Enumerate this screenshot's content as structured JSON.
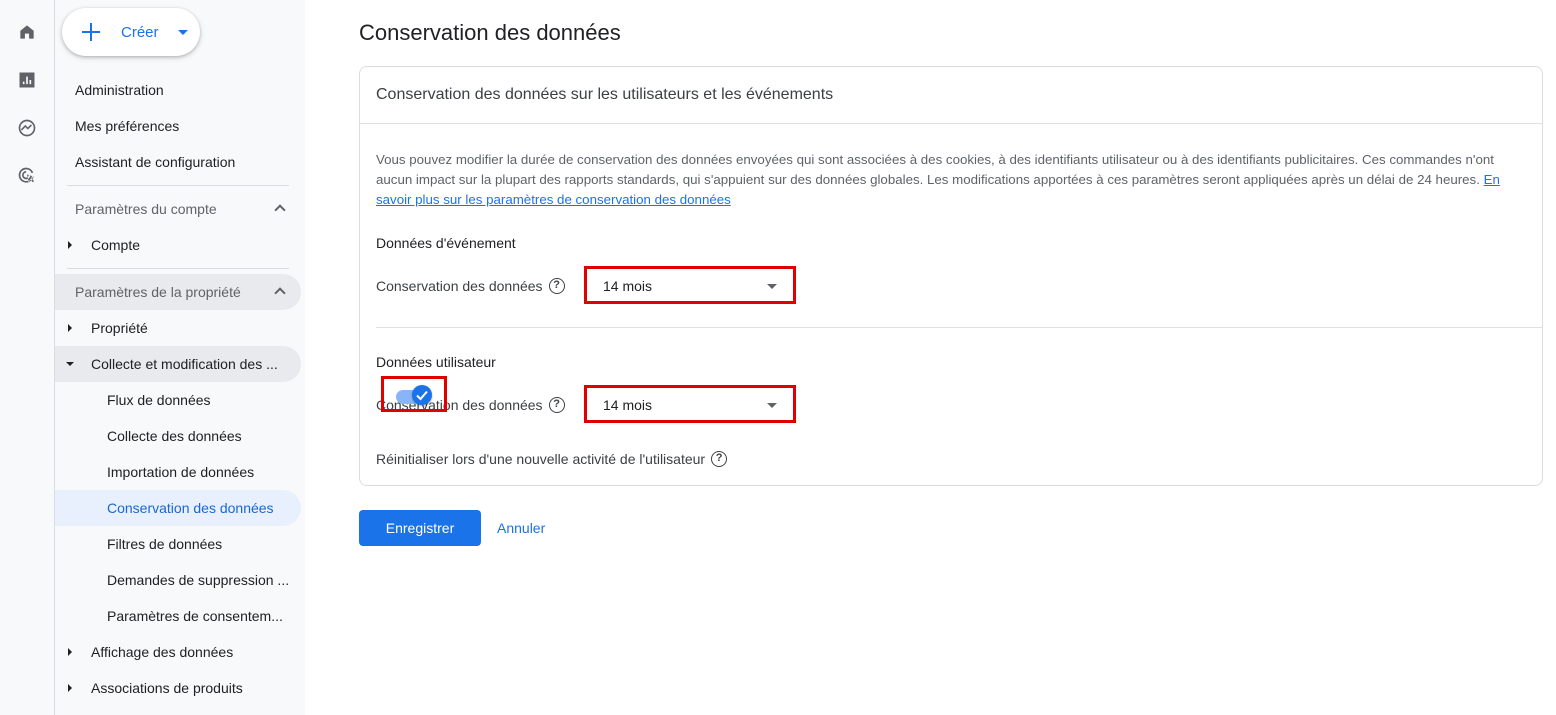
{
  "rail": {
    "icons": [
      "home-icon",
      "reports-icon",
      "explore-icon",
      "advertising-icon"
    ]
  },
  "sidebar": {
    "create_label": "Créer",
    "top_items": [
      "Administration",
      "Mes préférences",
      "Assistant de configuration"
    ],
    "account_section": "Paramètres du compte",
    "account_item": "Compte",
    "property_section": "Paramètres de la propriété",
    "property_item": "Propriété",
    "collection_group": "Collecte et modification des ...",
    "collection_children": [
      "Flux de données",
      "Collecte des données",
      "Importation de données",
      "Conservation des données",
      "Filtres de données",
      "Demandes de suppression ...",
      "Paramètres de consentem..."
    ],
    "active_child": "Conservation des données",
    "bottom_items": [
      "Affichage des données",
      "Associations de produits"
    ]
  },
  "main": {
    "page_title": "Conservation des données",
    "card_title": "Conservation des données sur les utilisateurs et les événements",
    "description": "Vous pouvez modifier la durée de conservation des données envoyées qui sont associées à des cookies, à des identifiants utilisateur ou à des identifiants publicitaires. Ces commandes n'ont aucun impact sur la plupart des rapports standards, qui s'appuient sur des données globales. Les modifications apportées à ces paramètres seront appliquées après un délai de 24 heures.",
    "learn_more": "En savoir plus sur les paramètres de conservation des données",
    "event_section": {
      "title": "Données d'événement",
      "label": "Conservation des données",
      "value": "14 mois"
    },
    "user_section": {
      "title": "Données utilisateur",
      "label": "Conservation des données",
      "value": "14 mois"
    },
    "reset_label": "Réinitialiser lors d'une nouvelle activité de l'utilisateur",
    "reset_enabled": true,
    "save_label": "Enregistrer",
    "cancel_label": "Annuler"
  },
  "colors": {
    "accent": "#1a73e8",
    "highlight_box": "#e00000",
    "active_nav_bg": "#e8f0fe"
  }
}
